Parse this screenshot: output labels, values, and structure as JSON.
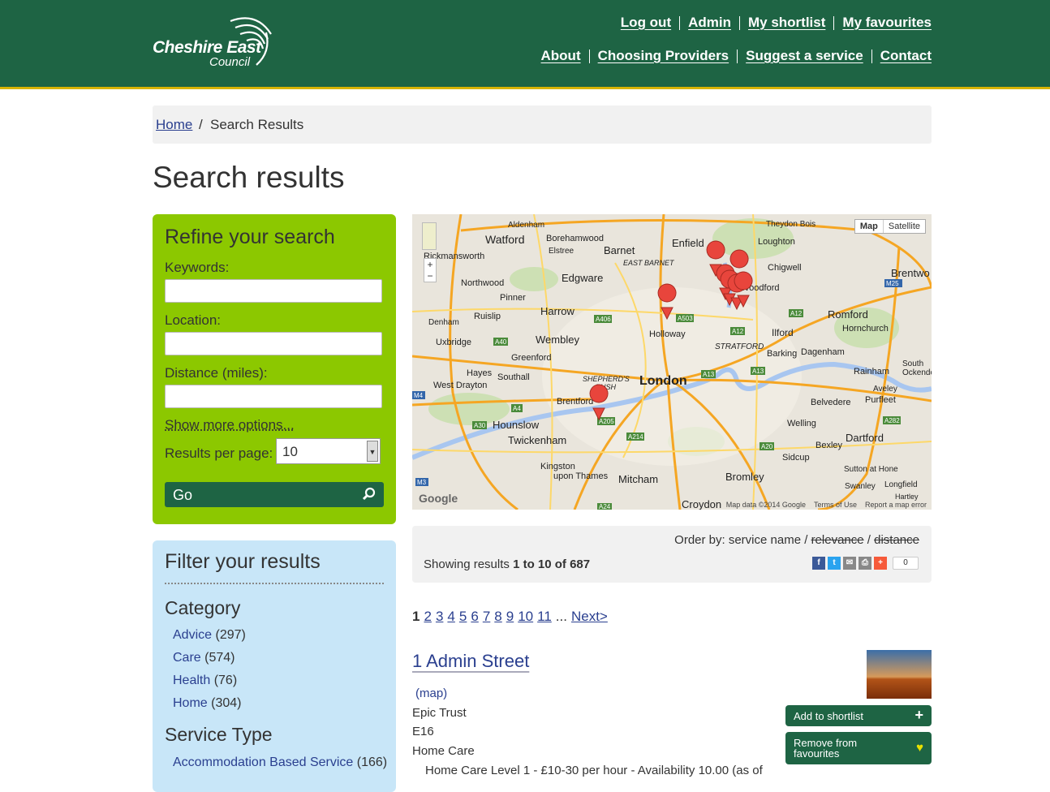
{
  "header": {
    "logo_line1": "Cheshire East",
    "logo_line2": "Council",
    "top_links": [
      "Log out",
      "Admin",
      "My shortlist",
      "My favourites"
    ],
    "main_links": [
      "About",
      "Choosing Providers",
      "Suggest a service",
      "Contact"
    ],
    "colors": {
      "band": "#1e6444",
      "accent": "#d8b400"
    }
  },
  "breadcrumb": {
    "home": "Home",
    "separator": "/",
    "current": "Search Results"
  },
  "page_title": "Search results",
  "refine": {
    "title": "Refine your search",
    "keywords_label": "Keywords:",
    "keywords_value": "",
    "location_label": "Location:",
    "location_value": "",
    "distance_label": "Distance (miles):",
    "distance_value": "",
    "more_options": "Show more options...",
    "results_per_page_label": "Results per page:",
    "results_per_page_value": "10",
    "go_label": "Go",
    "color": "#8cc800"
  },
  "filter": {
    "title": "Filter your results",
    "category_heading": "Category",
    "categories": [
      {
        "label": "Advice",
        "count": "(297)"
      },
      {
        "label": "Care",
        "count": "(574)"
      },
      {
        "label": "Health",
        "count": "(76)"
      },
      {
        "label": "Home",
        "count": "(304)"
      }
    ],
    "service_type_heading": "Service Type",
    "service_types": [
      {
        "label": "Accommodation Based Service",
        "count": "(166)"
      }
    ],
    "color": "#c8e6f8"
  },
  "map": {
    "type_map": "Map",
    "type_satellite": "Satellite",
    "attribution": "Map data ©2014 Google",
    "terms": "Terms of Use",
    "report": "Report a map error",
    "logo": "Google",
    "places": [
      "Watford",
      "Barnet",
      "Enfield",
      "Edgware",
      "Harrow",
      "Wembley",
      "London",
      "Romford",
      "Ilford",
      "Hounslow",
      "Twickenham",
      "Bromley",
      "Croydon",
      "Dartford",
      "Mitcham",
      "Kingston upon Thames",
      "Brentford",
      "Loughton",
      "Chigwell",
      "Stratford",
      "Barking",
      "Dagenham",
      "Holloway",
      "Sidcup",
      "Bexley",
      "Welling",
      "Hornchurch",
      "Rainham",
      "Belvedere",
      "Purfleet",
      "Aveley",
      "Swanley",
      "Southall",
      "Greenford",
      "Northwood",
      "Pinner",
      "Ruislip",
      "Uxbridge",
      "Denham",
      "Hayes",
      "West Drayton",
      "Borehamwood",
      "Elstree",
      "Aldenham",
      "Rickmansworth",
      "Theydon Bois",
      "Brentwood",
      "South Ockendon",
      "Sutton at Hone",
      "Longfield",
      "Hartley",
      "Shepherd's Bush",
      "East Barnet",
      "Woodford"
    ],
    "roads": [
      "A503",
      "A406",
      "A40",
      "A12",
      "A13",
      "A4",
      "A30",
      "A205",
      "A214",
      "A20",
      "A282",
      "A24",
      "M4",
      "M3",
      "M25"
    ]
  },
  "results_toolbar": {
    "order_prefix": "Order by: service name /",
    "order_relevance": "relevance",
    "order_slash": "/",
    "order_distance": "distance",
    "showing_prefix": "Showing results",
    "showing_range": "1 to 10 of 687",
    "share_count": "0"
  },
  "pagination": {
    "current": "1",
    "pages": [
      "2",
      "3",
      "4",
      "5",
      "6",
      "7",
      "8",
      "9",
      "10",
      "11"
    ],
    "ellipsis": "...",
    "next": "Next>"
  },
  "result": {
    "title": "1 Admin Street",
    "map_link": "(map)",
    "provider": "Epic Trust",
    "postcode": "E16",
    "category": "Home Care",
    "detail": "Home Care Level 1 - £10-30 per hour - Availability 10.00 (as of",
    "shortlist_label": "Add to shortlist",
    "favourites_label": "Remove from favourites"
  }
}
